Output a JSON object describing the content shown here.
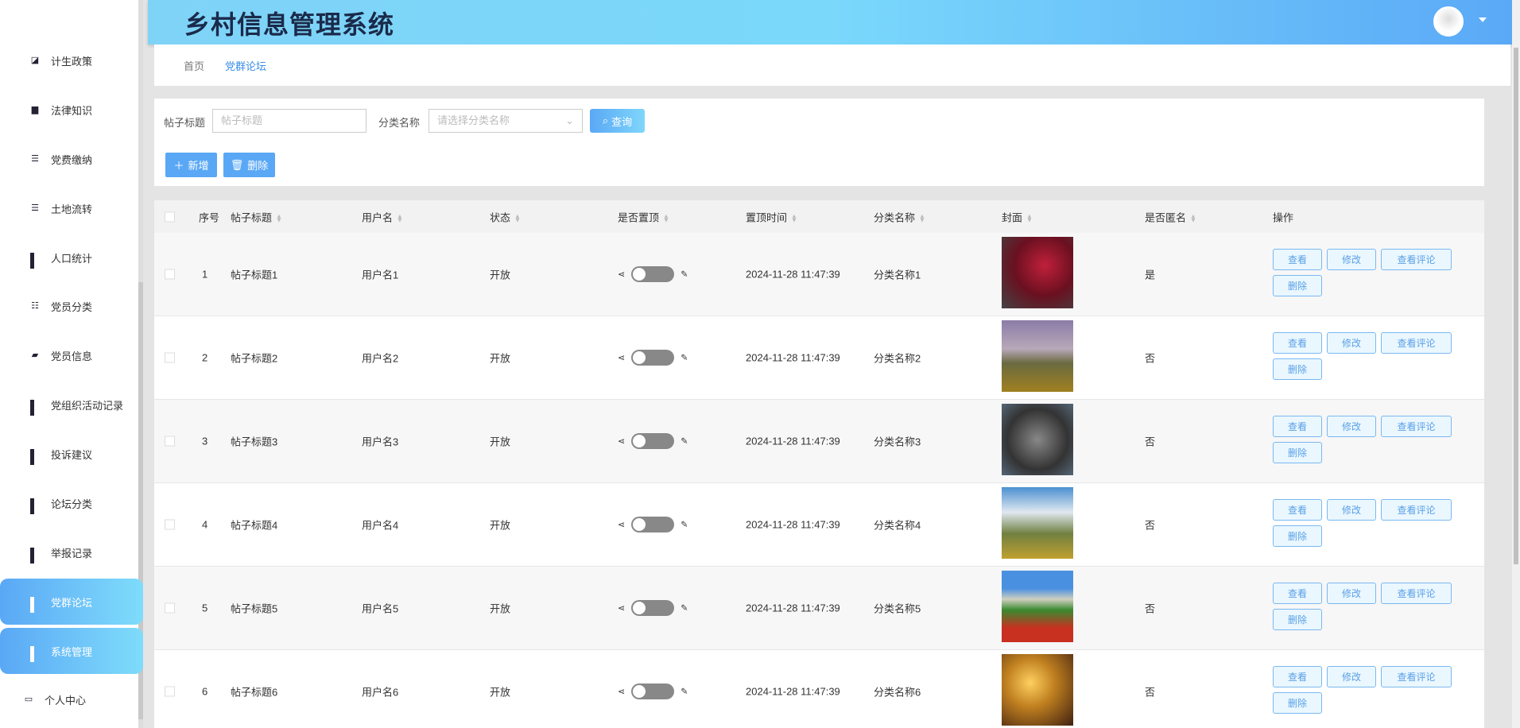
{
  "app_title": "乡村信息管理系统",
  "sidebar": {
    "items": [
      {
        "label": "计生政策",
        "icon": "chart-icon"
      },
      {
        "label": "法律知识",
        "icon": "briefcase-icon"
      },
      {
        "label": "党费缴纳",
        "icon": "list-icon"
      },
      {
        "label": "土地流转",
        "icon": "list-icon"
      },
      {
        "label": "人口统计",
        "icon": "grid-icon"
      },
      {
        "label": "党员分类",
        "icon": "sliders-icon"
      },
      {
        "label": "党员信息",
        "icon": "wallet-icon"
      },
      {
        "label": "党组织活动记录",
        "icon": "grid-icon"
      },
      {
        "label": "投诉建议",
        "icon": "grid-icon"
      },
      {
        "label": "论坛分类",
        "icon": "grid-icon"
      },
      {
        "label": "举报记录",
        "icon": "grid-icon"
      },
      {
        "label": "党群论坛",
        "icon": "grid-icon"
      },
      {
        "label": "系统管理",
        "icon": "grid-icon"
      },
      {
        "label": "个人中心",
        "icon": "card-icon"
      }
    ]
  },
  "breadcrumb": {
    "home": "首页",
    "current": "党群论坛"
  },
  "search": {
    "title_label": "帖子标题",
    "title_placeholder": "帖子标题",
    "category_label": "分类名称",
    "category_placeholder": "请选择分类名称",
    "query": "查询",
    "add": "新增",
    "delete": "删除"
  },
  "table": {
    "headers": [
      "序号",
      "帖子标题",
      "用户名",
      "状态",
      "是否置顶",
      "置顶时间",
      "分类名称",
      "封面",
      "是否匿名",
      "操作"
    ],
    "actions": {
      "view": "查看",
      "edit": "修改",
      "comments": "查看评论",
      "delete": "删除"
    },
    "rows": [
      {
        "no": "1",
        "title": "帖子标题1",
        "user": "用户名1",
        "status": "开放",
        "time": "2024-11-28 11:47:39",
        "category": "分类名称1",
        "anon": "是"
      },
      {
        "no": "2",
        "title": "帖子标题2",
        "user": "用户名2",
        "status": "开放",
        "time": "2024-11-28 11:47:39",
        "category": "分类名称2",
        "anon": "否"
      },
      {
        "no": "3",
        "title": "帖子标题3",
        "user": "用户名3",
        "status": "开放",
        "time": "2024-11-28 11:47:39",
        "category": "分类名称3",
        "anon": "否"
      },
      {
        "no": "4",
        "title": "帖子标题4",
        "user": "用户名4",
        "status": "开放",
        "time": "2024-11-28 11:47:39",
        "category": "分类名称4",
        "anon": "否"
      },
      {
        "no": "5",
        "title": "帖子标题5",
        "user": "用户名5",
        "status": "开放",
        "time": "2024-11-28 11:47:39",
        "category": "分类名称5",
        "anon": "否"
      },
      {
        "no": "6",
        "title": "帖子标题6",
        "user": "用户名6",
        "status": "开放",
        "time": "2024-11-28 11:47:39",
        "category": "分类名称6",
        "anon": "否"
      }
    ]
  },
  "colors": {
    "accent": "#5aa8f5",
    "header_start": "#7fd3f7",
    "header_end": "#5aa9f7"
  }
}
